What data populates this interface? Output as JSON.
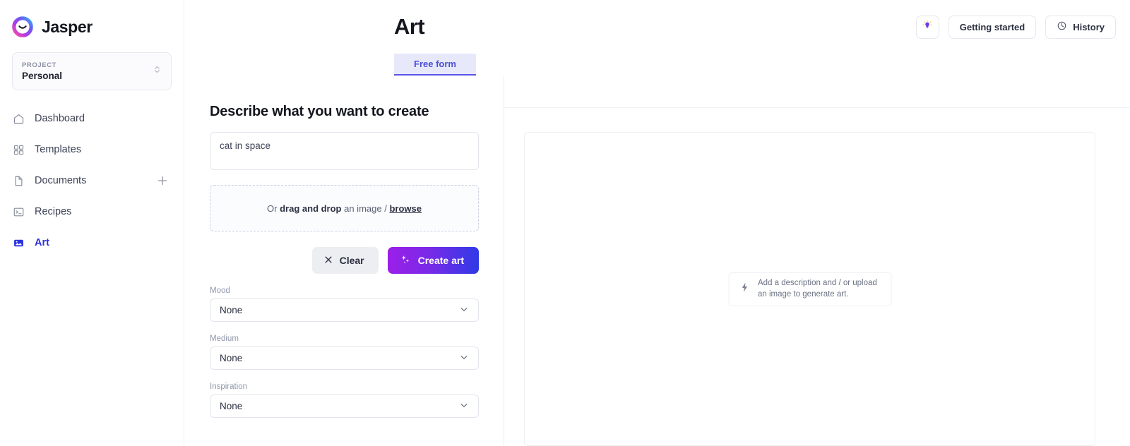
{
  "brand": {
    "name": "Jasper",
    "logo_icon": "jasper-logo-icon"
  },
  "project": {
    "label": "PROJECT",
    "value": "Personal",
    "selector_icon": "chevron-up-down-icon"
  },
  "sidebar": {
    "items": [
      {
        "label": "Dashboard",
        "icon": "home-icon",
        "active": false
      },
      {
        "label": "Templates",
        "icon": "grid-icon",
        "active": false
      },
      {
        "label": "Documents",
        "icon": "document-icon",
        "active": false,
        "action_icon": "plus-icon"
      },
      {
        "label": "Recipes",
        "icon": "terminal-icon",
        "active": false
      },
      {
        "label": "Art",
        "icon": "image-icon",
        "active": true
      }
    ],
    "active_color": "#2a32e0"
  },
  "header": {
    "title": "Art",
    "inspiration_button": {
      "label": "",
      "icon": "lightbulb-sparkle-icon"
    },
    "getting_started_button": {
      "label": "Getting started"
    },
    "history_button": {
      "label": "History",
      "icon": "clock-icon"
    }
  },
  "tabs": [
    {
      "label": "Free form",
      "active": true
    }
  ],
  "form": {
    "heading": "Describe what you want to create",
    "prompt": {
      "value": "cat in space",
      "placeholder": "Describe what you want to create"
    },
    "dropzone": {
      "prefix": "Or ",
      "strong": "drag and drop",
      "middle": " an image / ",
      "link": "browse"
    },
    "clear_button": {
      "label": "Clear",
      "icon": "close-icon"
    },
    "create_button": {
      "label": "Create art",
      "icon": "sparkles-icon",
      "gradient_from": "#9b1fe8",
      "gradient_to": "#2f3ae6"
    },
    "fields": [
      {
        "label": "Mood",
        "value": "None",
        "chevron_icon": "chevron-down-icon"
      },
      {
        "label": "Medium",
        "value": "None",
        "chevron_icon": "chevron-down-icon"
      },
      {
        "label": "Inspiration",
        "value": "None",
        "chevron_icon": "chevron-down-icon"
      }
    ]
  },
  "canvas": {
    "hint_icon": "lightning-bolt-icon",
    "hint_line1": "Add a description and / or upload",
    "hint_line2": "an image to generate art."
  }
}
